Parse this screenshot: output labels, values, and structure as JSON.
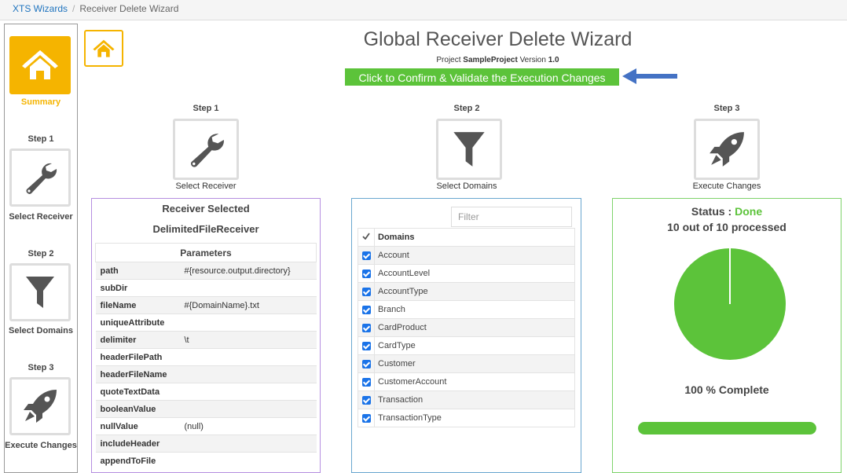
{
  "breadcrumb": {
    "root": "XTS Wizards",
    "separator": "/",
    "current": "Receiver Delete Wizard"
  },
  "sidebar": {
    "summary_label": "Summary",
    "steps": [
      {
        "step": "Step 1",
        "label": "Select Receiver",
        "icon": "wrench-icon"
      },
      {
        "step": "Step 2",
        "label": "Select Domains",
        "icon": "filter-icon"
      },
      {
        "step": "Step 3",
        "label": "Execute Changes",
        "icon": "rocket-icon"
      }
    ]
  },
  "header": {
    "title": "Global Receiver Delete Wizard",
    "project_prefix": "Project",
    "project_name": "SampleProject",
    "version_prefix": "Version",
    "version": "1.0",
    "confirm_button": "Click to Confirm & Validate the Execution Changes"
  },
  "steps": [
    {
      "step": "Step 1",
      "label": "Select Receiver"
    },
    {
      "step": "Step 2",
      "label": "Select Domains"
    },
    {
      "step": "Step 3",
      "label": "Execute Changes"
    }
  ],
  "receiver_panel": {
    "title": "Receiver Selected",
    "receiver_name": "DelimitedFileReceiver",
    "params_header": "Parameters",
    "params": [
      {
        "key": "path",
        "value": "#{resource.output.directory}"
      },
      {
        "key": "subDir",
        "value": ""
      },
      {
        "key": "fileName",
        "value": "#{DomainName}.txt"
      },
      {
        "key": "uniqueAttribute",
        "value": ""
      },
      {
        "key": "delimiter",
        "value": "\\t"
      },
      {
        "key": "headerFilePath",
        "value": ""
      },
      {
        "key": "headerFileName",
        "value": ""
      },
      {
        "key": "quoteTextData",
        "value": ""
      },
      {
        "key": "booleanValue",
        "value": ""
      },
      {
        "key": "nullValue",
        "value": "(null)"
      },
      {
        "key": "includeHeader",
        "value": ""
      },
      {
        "key": "appendToFile",
        "value": ""
      }
    ]
  },
  "domains_panel": {
    "filter_placeholder": "Filter",
    "column_header": "Domains",
    "items": [
      "Account",
      "AccountLevel",
      "AccountType",
      "Branch",
      "CardProduct",
      "CardType",
      "Customer",
      "CustomerAccount",
      "Transaction",
      "TransactionType"
    ]
  },
  "execute_panel": {
    "status_label": "Status :",
    "status_value": "Done",
    "processed_text": "10 out of 10 processed",
    "processed": 10,
    "total": 10,
    "complete_text": "100 % Complete",
    "progress_percent": 100
  },
  "colors": {
    "accent": "#f5b400",
    "success": "#5cc33a",
    "link": "#1e73be",
    "arrow": "#4472c4"
  }
}
